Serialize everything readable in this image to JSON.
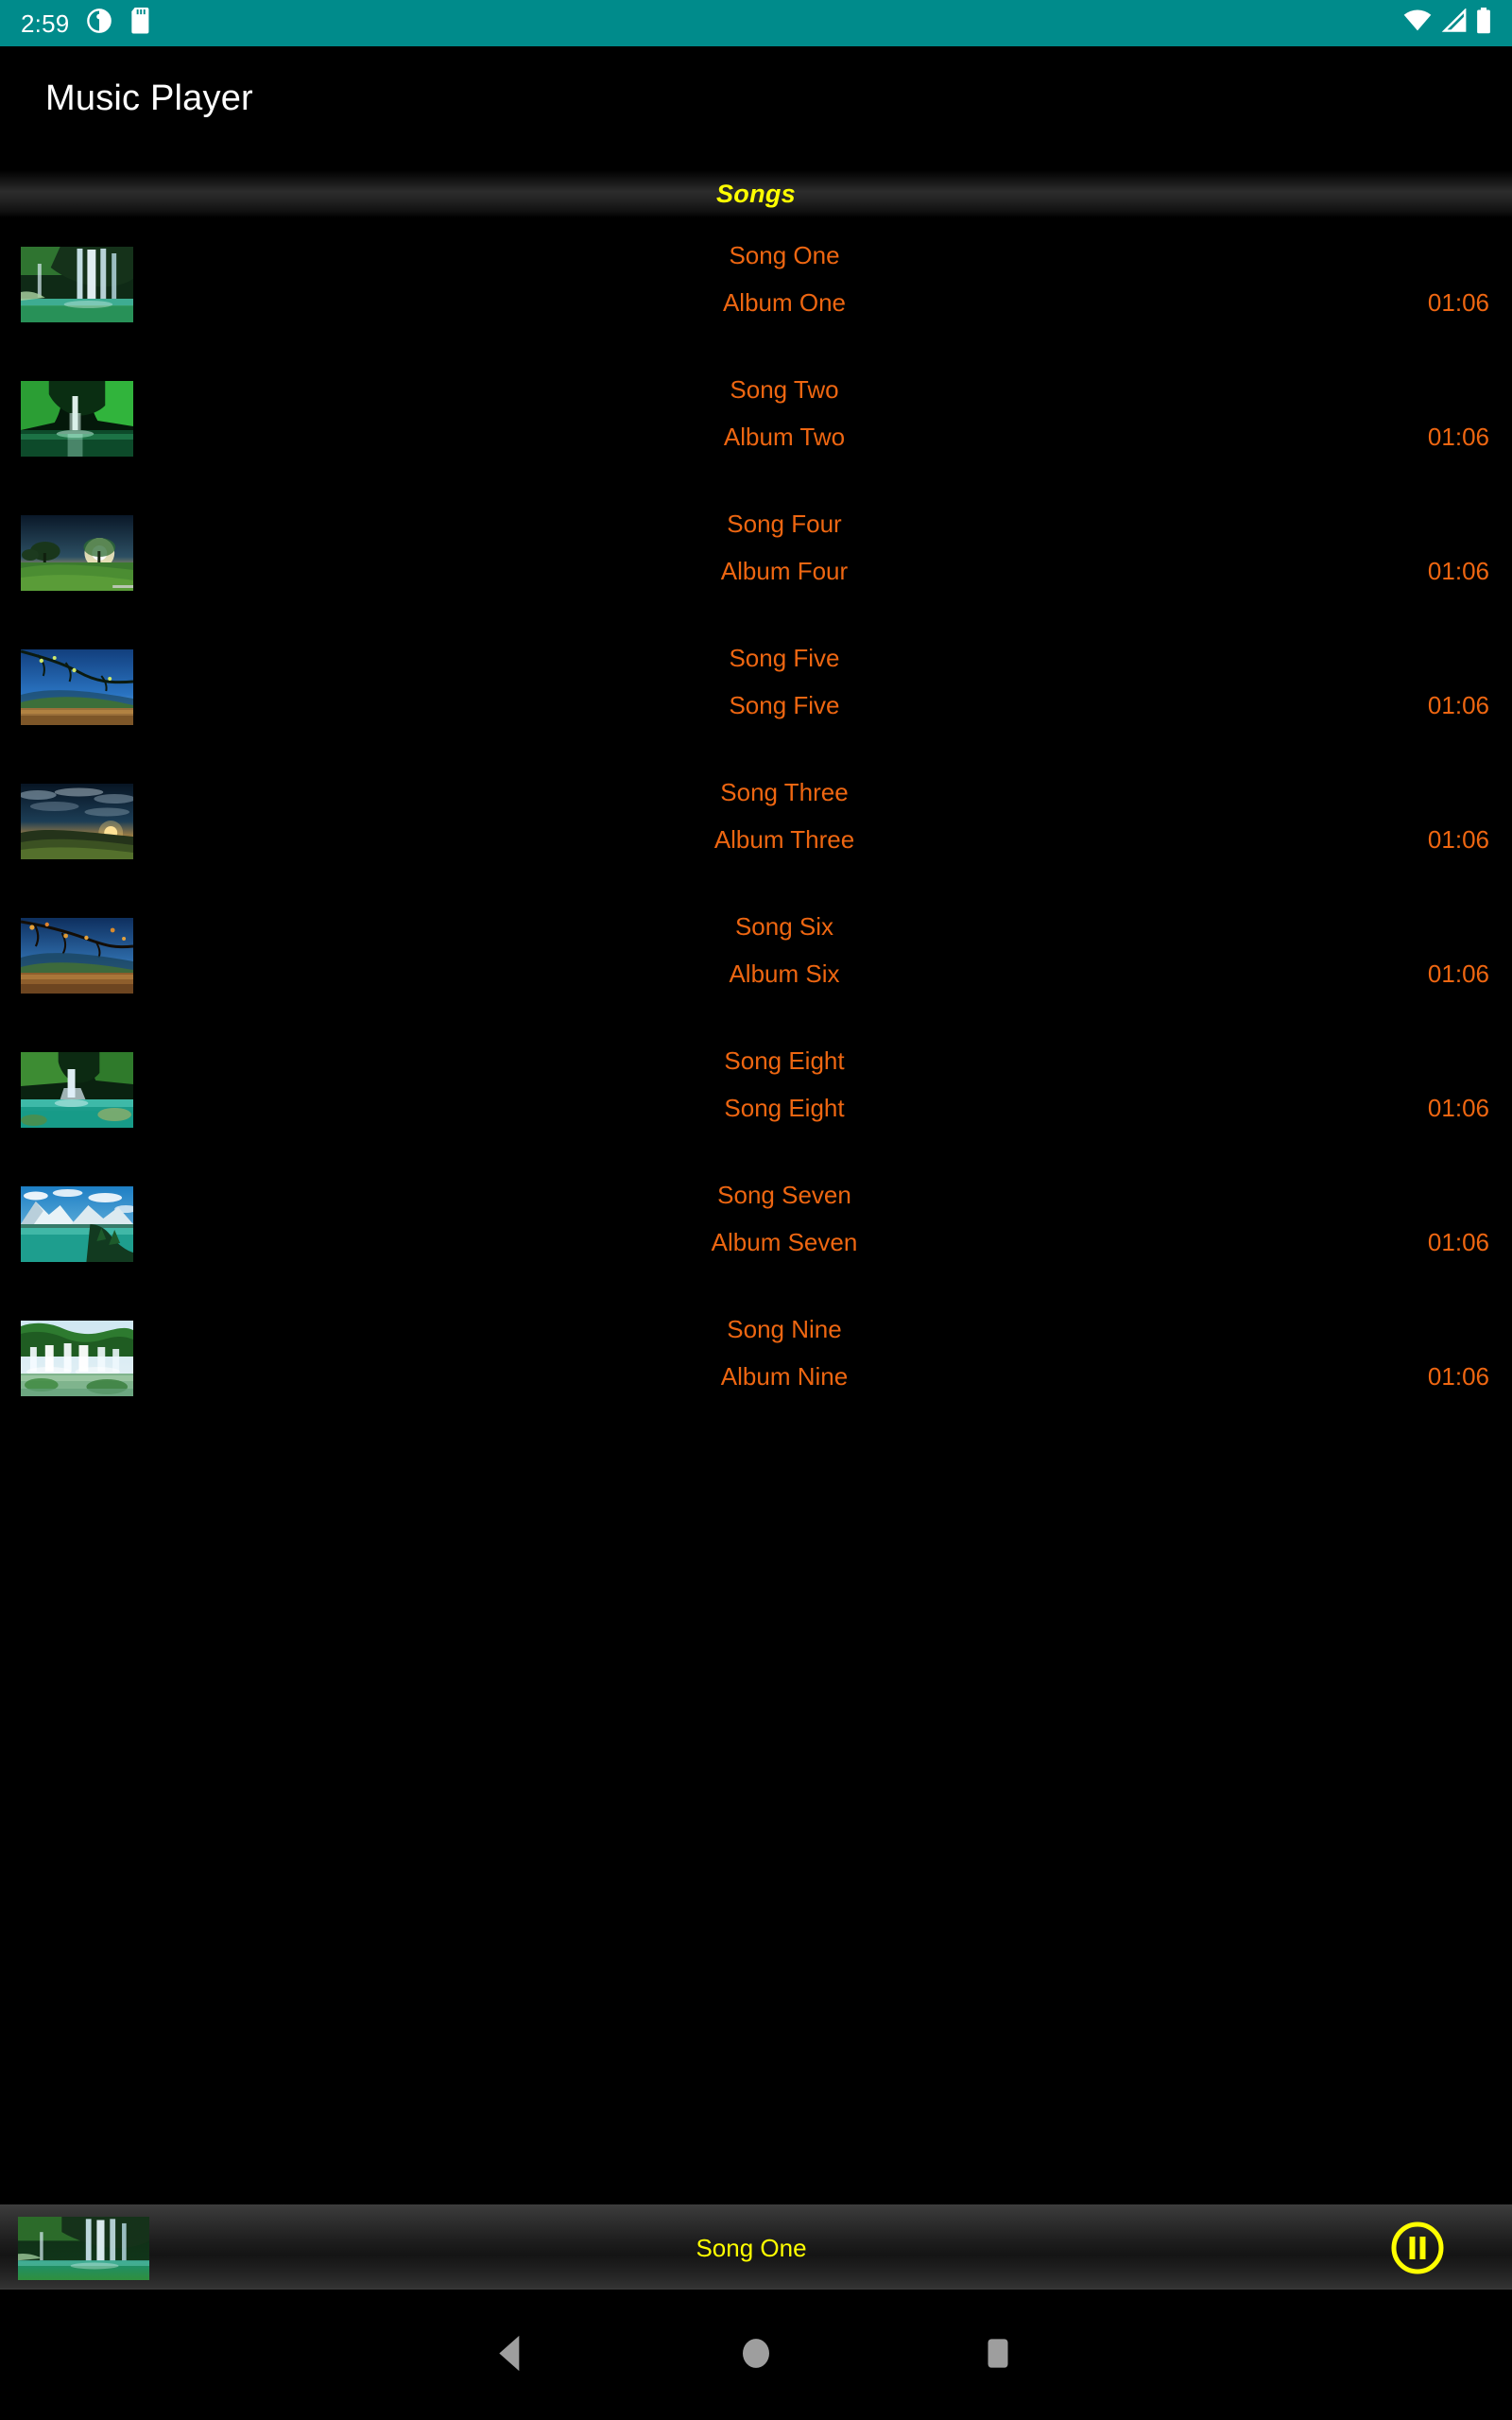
{
  "status_bar": {
    "clock": "2:59",
    "background_color": "#008b8b",
    "left_icons": [
      "contrast-circle-icon",
      "sd-card-icon"
    ],
    "right_icons": [
      "wifi-icon",
      "cellular-signal-icon",
      "battery-icon"
    ]
  },
  "app_bar": {
    "title": "Music Player",
    "title_color": "#ffffff",
    "background_color": "#000000"
  },
  "section_header": {
    "label": "Songs",
    "text_color": "#ffff00"
  },
  "list": {
    "text_color": "#ee6611",
    "rows": [
      {
        "title": "Song One",
        "album": "Album One",
        "duration": "01:06",
        "art": "waterfall-green-pool"
      },
      {
        "title": "Song Two",
        "album": "Album Two",
        "duration": "01:06",
        "art": "green-canyon-waterfall"
      },
      {
        "title": "Song Four",
        "album": "Album Four",
        "duration": "01:06",
        "art": "sunset-tree-field"
      },
      {
        "title": "Song Five",
        "album": "Song Five",
        "duration": "01:06",
        "art": "blue-sky-branches-hill"
      },
      {
        "title": "Song Three",
        "album": "Album Three",
        "duration": "01:06",
        "art": "sunset-cloudy-hills"
      },
      {
        "title": "Song Six",
        "album": "Album Six",
        "duration": "01:06",
        "art": "autumn-branches-valley"
      },
      {
        "title": "Song Eight",
        "album": "Song Eight",
        "duration": "01:06",
        "art": "forest-waterfall-lagoon"
      },
      {
        "title": "Song Seven",
        "album": "Album Seven",
        "duration": "01:06",
        "art": "mountain-lake-island"
      },
      {
        "title": "Song Nine",
        "album": "Album Nine",
        "duration": "01:06",
        "art": "wide-waterfalls-river"
      }
    ]
  },
  "player_bar": {
    "now_playing": "Song One",
    "now_playing_color": "#ffff00",
    "art": "waterfall-green-pool",
    "toggle_icon": "pause-icon",
    "toggle_color": "#ffff00"
  },
  "nav_bar": {
    "back_label": "back-icon",
    "home_label": "home-icon",
    "recents_label": "recents-icon",
    "icon_color": "#9e9e9e"
  }
}
